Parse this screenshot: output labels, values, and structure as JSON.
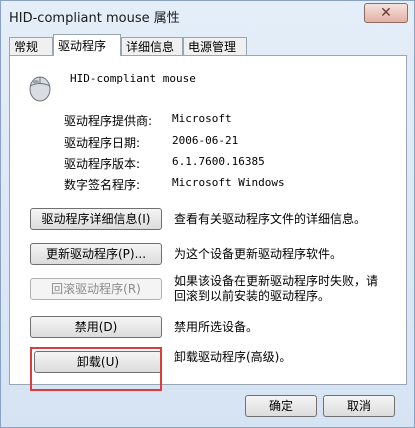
{
  "window": {
    "title": "HID-compliant mouse 属性",
    "close_glyph": "✕"
  },
  "tabs": [
    {
      "label": "常规"
    },
    {
      "label": "驱动程序"
    },
    {
      "label": "详细信息"
    },
    {
      "label": "电源管理"
    }
  ],
  "device": {
    "icon": "mouse-icon",
    "name": "HID-compliant mouse"
  },
  "info": [
    {
      "label": "驱动程序提供商:",
      "value": "Microsoft"
    },
    {
      "label": "驱动程序日期:",
      "value": "2006-06-21"
    },
    {
      "label": "驱动程序版本:",
      "value": "6.1.7600.16385"
    },
    {
      "label": "数字签名程序:",
      "value": "Microsoft Windows"
    }
  ],
  "actions": [
    {
      "button": "驱动程序详细信息(I)",
      "description": "查看有关驱动程序文件的详细信息。"
    },
    {
      "button": "更新驱动程序(P)...",
      "description": "为这个设备更新驱动程序软件。"
    },
    {
      "button": "回滚驱动程序(R)",
      "description_line1": "如果该设备在更新驱动程序时失败，请",
      "description_line2": "回滚到以前安装的驱动程序。"
    },
    {
      "button": "禁用(D)",
      "description": "禁用所选设备。"
    },
    {
      "button": "卸载(U)",
      "description": "卸载驱动程序(高级)。"
    }
  ],
  "footer": {
    "ok": "确定",
    "cancel": "取消"
  },
  "colors": {
    "highlight": "#e03a3a"
  }
}
